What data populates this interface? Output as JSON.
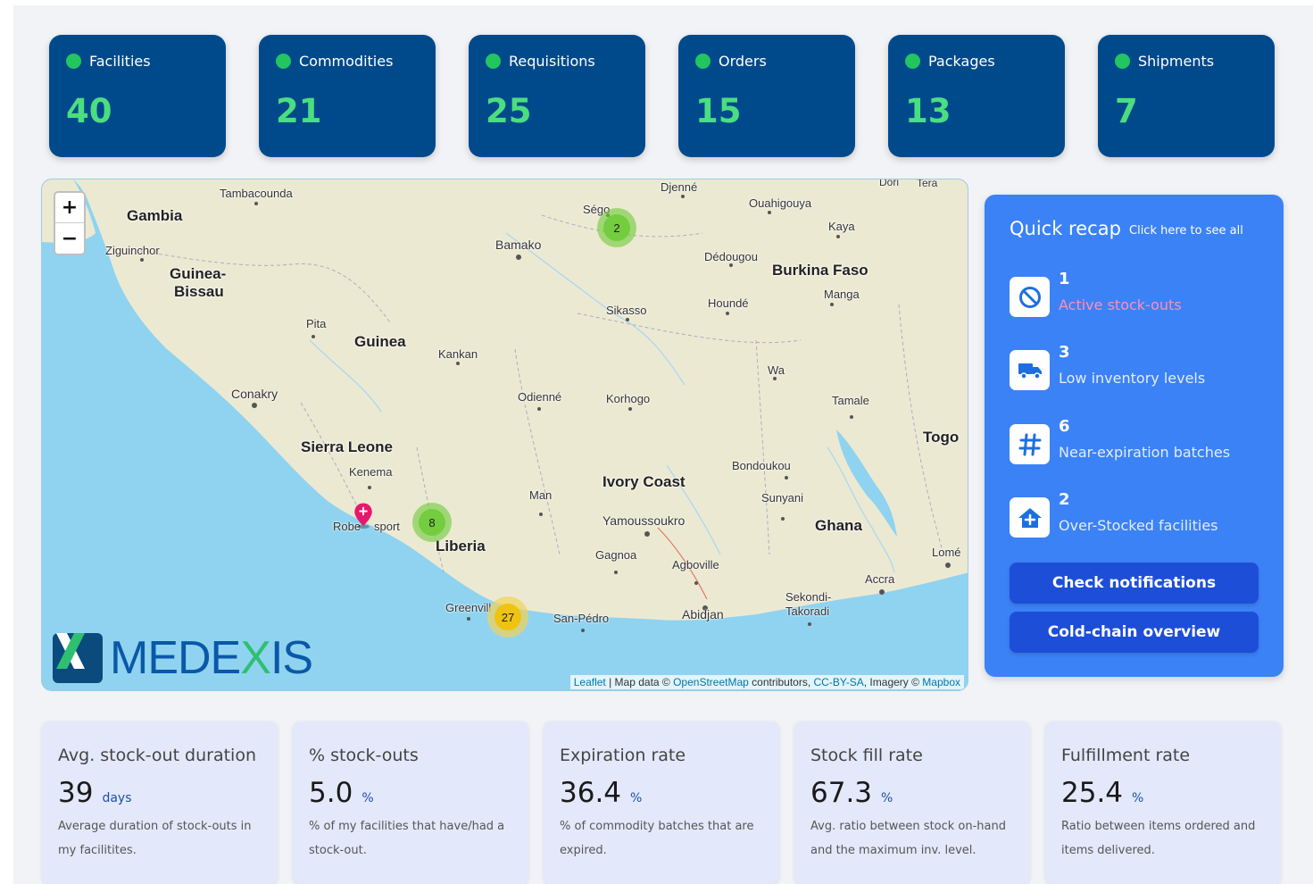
{
  "stats": [
    {
      "label": "Facilities",
      "value": "40"
    },
    {
      "label": "Commodities",
      "value": "21"
    },
    {
      "label": "Requisitions",
      "value": "25"
    },
    {
      "label": "Orders",
      "value": "15"
    },
    {
      "label": "Packages",
      "value": "13"
    },
    {
      "label": "Shipments",
      "value": "7"
    }
  ],
  "map": {
    "zoom_in": "+",
    "zoom_out": "−",
    "attribution": {
      "leaflet": "Leaflet",
      "sep1": " | Map data © ",
      "osm": "OpenStreetMap",
      "contrib": " contributors, ",
      "license": "CC-BY-SA",
      "imagery": ", Imagery © ",
      "mapbox": "Mapbox"
    },
    "logo": {
      "prefix": "MEDE",
      "x": "X",
      "suffix": "IS"
    },
    "countries": {
      "gambia": "Gambia",
      "guinea_bissau_1": "Guinea-",
      "guinea_bissau_2": "Bissau",
      "guinea": "Guinea",
      "sierra_leone": "Sierra Leone",
      "liberia": "Liberia",
      "ivory_coast": "Ivory Coast",
      "burkina_faso": "Burkina Faso",
      "ghana": "Ghana",
      "togo": "Togo"
    },
    "cities": {
      "tambacounda": "Tambacounda",
      "ziguinchor": "Ziguinchor",
      "bamako": "Bamako",
      "segou": "Ségo",
      "djenne": "Djenné",
      "ouahigouya": "Ouahigouya",
      "dori": "Dori",
      "tera": "Tera",
      "kaya": "Kaya",
      "dedougou": "Dédougou",
      "manga": "Manga",
      "hounde": "Houndé",
      "sikasso": "Sikasso",
      "pita": "Pita",
      "kankan": "Kankan",
      "conakry": "Conakry",
      "odienne": "Odienné",
      "korhogo": "Korhogo",
      "wa": "Wa",
      "tamale": "Tamale",
      "kenema": "Kenema",
      "robertsport_a": "Robe",
      "robertsport_b": "sport",
      "man": "Man",
      "bondoukou": "Bondoukou",
      "sunyani": "Sunyani",
      "yamoussoukro": "Yamoussoukro",
      "gagnoa": "Gagnoa",
      "agboville": "Agboville",
      "lome": "Lomé",
      "accra": "Accra",
      "greenville": "Greenvill",
      "san_pedro": "San-Pédro",
      "abidjan": "Abidjan",
      "sekondi_1": "Sekondi-",
      "sekondi_2": "Takoradi"
    },
    "clusters": [
      {
        "count": "2",
        "color": "#6ecc39"
      },
      {
        "count": "8",
        "color": "#6ecc39"
      },
      {
        "count": "27",
        "color": "#f0c20c"
      }
    ]
  },
  "recap": {
    "title": "Quick recap",
    "link": "Click here to see all",
    "items": [
      {
        "count": "1",
        "label": "Active stock-outs",
        "icon": "ban-icon"
      },
      {
        "count": "3",
        "label": "Low inventory levels",
        "icon": "truck-icon"
      },
      {
        "count": "6",
        "label": "Near-expiration batches",
        "icon": "hash-icon"
      },
      {
        "count": "2",
        "label": "Over-Stocked facilities",
        "icon": "house-icon"
      }
    ],
    "buttons": {
      "notifications": "Check notifications",
      "cold_chain": "Cold-chain overview"
    }
  },
  "kpis": [
    {
      "title": "Avg. stock-out duration",
      "value": "39",
      "unit": "days",
      "desc": "Average duration of stock-outs in my facilitites."
    },
    {
      "title": "% stock-outs",
      "value": "5.0",
      "unit": "%",
      "desc": "% of my facilities that have/had a stock-out."
    },
    {
      "title": "Expiration rate",
      "value": "36.4",
      "unit": "%",
      "desc": "% of commodity batches that are expired."
    },
    {
      "title": "Stock fill rate",
      "value": "67.3",
      "unit": "%",
      "desc": "Avg. ratio between stock on-hand and the maximum inv. level."
    },
    {
      "title": "Fulfillment rate",
      "value": "25.4",
      "unit": "%",
      "desc": "Ratio between items ordered and items delivered."
    }
  ],
  "colors": {
    "card_bg": "#004a8c",
    "accent_green": "#4ade80",
    "recap_bg": "#3b82f6",
    "alert_pink": "#ff8fb6",
    "kpi_bg": "#e3e9fb"
  }
}
